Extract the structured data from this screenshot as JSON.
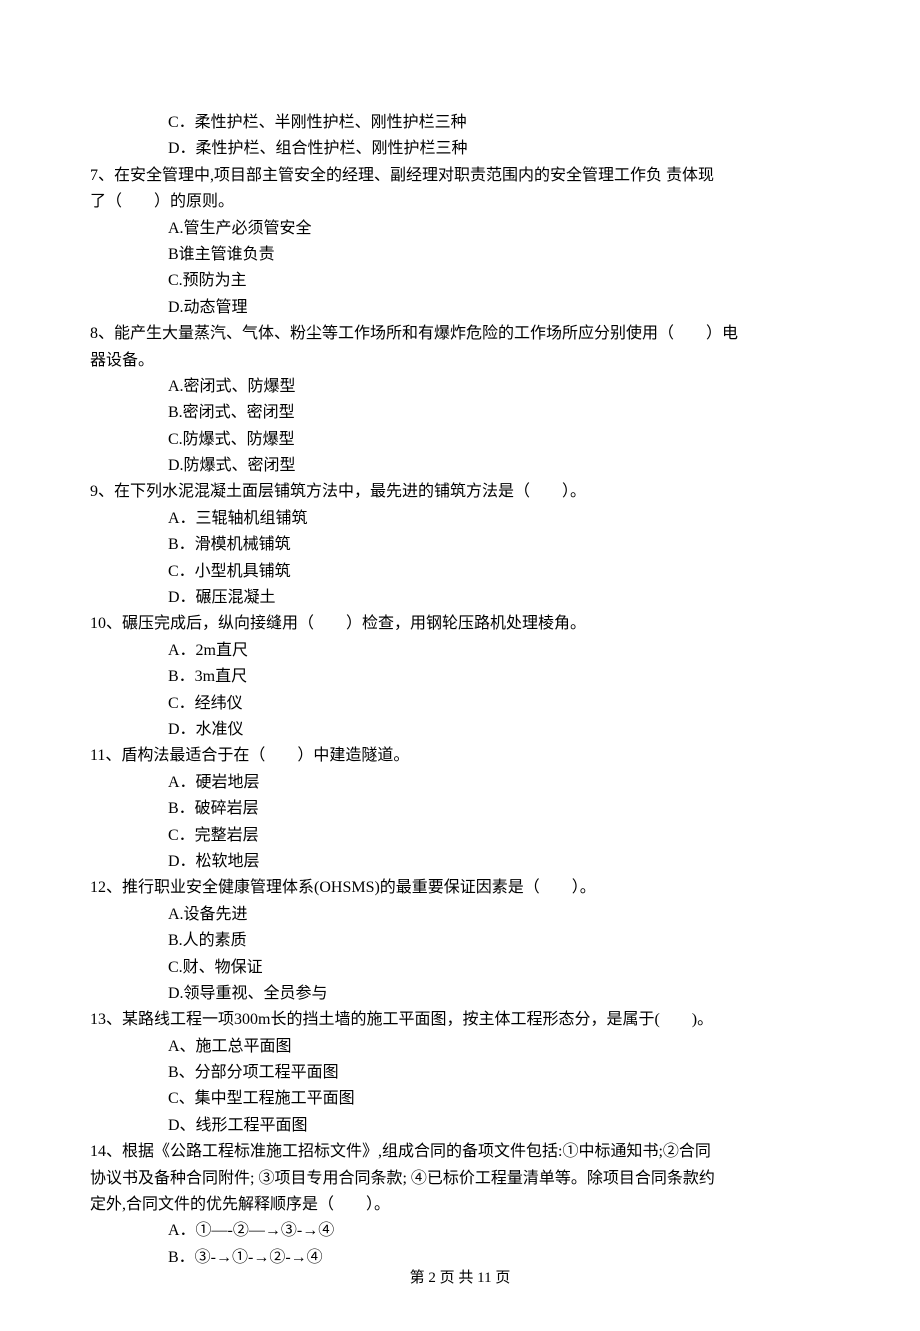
{
  "options_pre": [
    "C．柔性护栏、半刚性护栏、刚性护栏三种",
    "D．柔性护栏、组合性护栏、刚性护栏三种"
  ],
  "questions": [
    {
      "text": "7、在安全管理中,项目部主管安全的经理、副经理对职责范围内的安全管理工作负 责体现",
      "cont": "了（　　）的原则。",
      "options": [
        "A.管生产必须管安全",
        "B谁主管谁负责",
        "C.预防为主",
        "D.动态管理"
      ]
    },
    {
      "text": "8、能产生大量蒸汽、气体、粉尘等工作场所和有爆炸危险的工作场所应分别使用（　　）电",
      "cont": "器设备。",
      "options": [
        "A.密闭式、防爆型",
        "B.密闭式、密闭型",
        "C.防爆式、防爆型",
        "D.防爆式、密闭型"
      ]
    },
    {
      "text": "9、在下列水泥混凝土面层铺筑方法中，最先进的铺筑方法是（　　）。",
      "options": [
        "A．三辊轴机组铺筑",
        "B．滑模机械铺筑",
        "C．小型机具铺筑",
        "D．碾压混凝土"
      ]
    },
    {
      "text": "10、碾压完成后，纵向接缝用（　　）检查，用钢轮压路机处理棱角。",
      "options": [
        "A．2m直尺",
        "B．3m直尺",
        "C．经纬仪",
        "D．水准仪"
      ]
    },
    {
      "text": "11、盾构法最适合于在（　　）中建造隧道。",
      "options": [
        "A．硬岩地层",
        "B．破碎岩层",
        "C．完整岩层",
        "D．松软地层"
      ]
    },
    {
      "text": "12、推行职业安全健康管理体系(OHSMS)的最重要保证因素是（　　）。",
      "options": [
        "A.设备先进",
        "B.人的素质",
        "C.财、物保证",
        "D.领导重视、全员参与"
      ]
    },
    {
      "text": "13、某路线工程一项300m长的挡土墙的施工平面图，按主体工程形态分，是属于(　　)。",
      "options": [
        "A、施工总平面图",
        "B、分部分项工程平面图",
        "C、集中型工程施工平面图",
        "D、线形工程平面图"
      ]
    },
    {
      "text": "14、根据《公路工程标准施工招标文件》,组成合同的备项文件包括:①中标通知书;②合同",
      "cont": "协议书及备种合同附件; ③项目专用合同条款; ④已标价工程量清单等。除项目合同条款约",
      "cont2": "定外,合同文件的优先解释顺序是（　　）。",
      "options": [
        "A．①—-②—→③-→④",
        "B．③-→①-→②-→④"
      ]
    }
  ],
  "footer": "第 2 页 共 11 页"
}
